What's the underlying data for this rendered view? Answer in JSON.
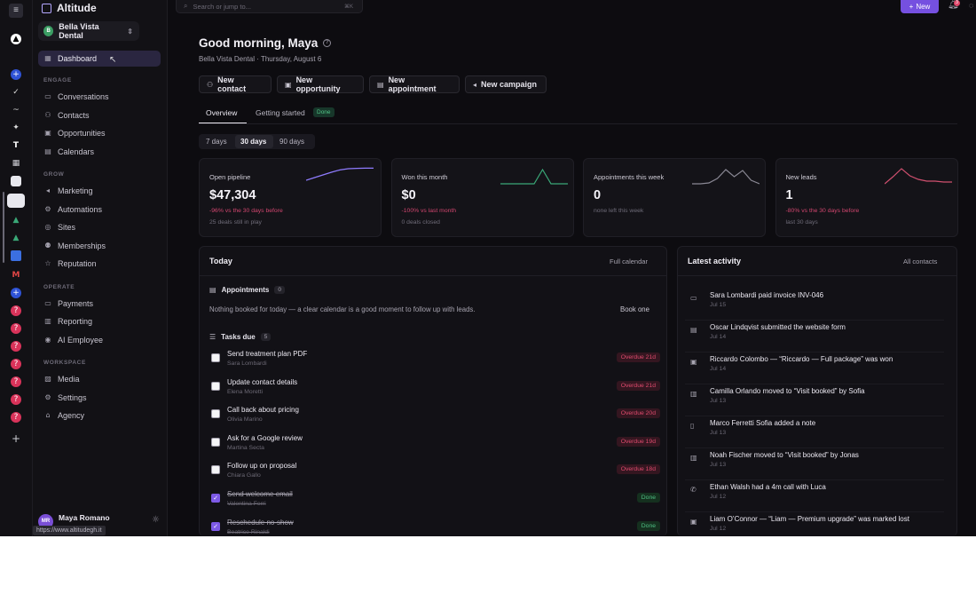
{
  "app": {
    "name": "Altitude",
    "account": "Bella Vista Dental",
    "account_initial": "B",
    "status_url": "https://www.altitudegh.it"
  },
  "sidebar": {
    "dashboard": "Dashboard",
    "sections": [
      {
        "title": "ENGAGE",
        "items": [
          "Conversations",
          "Contacts",
          "Opportunities",
          "Calendars"
        ]
      },
      {
        "title": "GROW",
        "items": [
          "Marketing",
          "Automations",
          "Sites",
          "Memberships",
          "Reputation"
        ]
      },
      {
        "title": "OPERATE",
        "items": [
          "Payments",
          "Reporting",
          "AI Employee"
        ]
      },
      {
        "title": "WORKSPACE",
        "items": [
          "Media",
          "Settings",
          "Agency"
        ]
      }
    ],
    "user": {
      "initials": "MR",
      "name": "Maya Romano"
    }
  },
  "topbar": {
    "search_placeholder": "Search or jump to...",
    "shortcut": "⌘K",
    "new_label": "New",
    "notification_count": "3"
  },
  "header": {
    "greeting": "Good morning, Maya",
    "subline": "Bella Vista Dental · Thursday, August 6",
    "actions": [
      "New contact",
      "New opportunity",
      "New appointment",
      "New campaign"
    ],
    "tabs": [
      "Overview",
      "Getting started"
    ],
    "tab_badge": "Done",
    "ranges": [
      "7 days",
      "30 days",
      "90 days"
    ],
    "selected_range": "30 days"
  },
  "kpis": [
    {
      "label": "Open pipeline",
      "value": "$47,304",
      "delta": "-96% vs the 30 days before",
      "foot": "25 deals still in play",
      "trend": [
        0.3,
        0.45,
        0.6,
        0.75,
        0.88,
        0.95,
        0.97,
        0.98,
        0.98
      ],
      "color": "#8f7cff"
    },
    {
      "label": "Won this month",
      "value": "$0",
      "delta": "-100% vs last month",
      "foot": "0 deals closed",
      "trend": [
        0.1,
        0.1,
        0.1,
        0.1,
        0.1,
        0.9,
        0.1,
        0.1,
        0.1
      ],
      "color": "#3aa877"
    },
    {
      "label": "Appointments this week",
      "value": "0",
      "delta": "none left this week",
      "foot": "",
      "trend": [
        0.1,
        0.1,
        0.15,
        0.4,
        0.9,
        0.5,
        0.85,
        0.3,
        0.1
      ],
      "color": "#8a8894"
    },
    {
      "label": "New leads",
      "value": "1",
      "delta": "-80% vs the 30 days before",
      "foot": "last 30 days",
      "trend": [
        0.1,
        0.5,
        0.95,
        0.55,
        0.35,
        0.25,
        0.25,
        0.2,
        0.2
      ],
      "color": "#d0506f"
    }
  ],
  "today": {
    "title": "Today",
    "link": "Full calendar",
    "appointments_label": "Appointments",
    "appointments_count": "0",
    "empty_text": "Nothing booked for today — a clear calendar is a good moment to follow up with leads.",
    "book_one": "Book one",
    "tasks_label": "Tasks due",
    "tasks_count": "5",
    "tasks": [
      {
        "title": "Send treatment plan PDF",
        "person": "Sara Lombardi",
        "status": "Overdue 21d",
        "done": false
      },
      {
        "title": "Update contact details",
        "person": "Elena Moretti",
        "status": "Overdue 21d",
        "done": false
      },
      {
        "title": "Call back about pricing",
        "person": "Olivia Marino",
        "status": "Overdue 20d",
        "done": false
      },
      {
        "title": "Ask for a Google review",
        "person": "Martina Secta",
        "status": "Overdue 19d",
        "done": false
      },
      {
        "title": "Follow up on proposal",
        "person": "Chiara Gallo",
        "status": "Overdue 18d",
        "done": false
      },
      {
        "title": "Send welcome email",
        "person": "Valentina Ferri",
        "status": "Done",
        "done": true
      },
      {
        "title": "Reschedule no-show",
        "person": "Beatrice Rinaldi",
        "status": "Done",
        "done": true
      }
    ]
  },
  "activity": {
    "title": "Latest activity",
    "link": "All contacts",
    "items": [
      {
        "icon": "invoice-icon",
        "text": "Sara Lombardi paid invoice INV-046",
        "date": "Jul 15"
      },
      {
        "icon": "form-icon",
        "text": "Oscar Lindqvist submitted the website form",
        "date": "Jul 14"
      },
      {
        "icon": "deal-icon",
        "text": "Riccardo Colombo — “Riccardo — Full package” was won",
        "date": "Jul 14"
      },
      {
        "icon": "stage-icon",
        "text": "Camilla Orlando moved to “Visit booked” by Sofia",
        "date": "Jul 13"
      },
      {
        "icon": "note-icon",
        "text": "Marco Ferretti Sofia added a note",
        "date": "Jul 13"
      },
      {
        "icon": "stage-icon",
        "text": "Noah Fischer moved to “Visit booked” by Jonas",
        "date": "Jul 13"
      },
      {
        "icon": "phone-icon",
        "text": "Ethan Walsh had a 4m call with Luca",
        "date": "Jul 12"
      },
      {
        "icon": "deal-icon",
        "text": "Liam O’Connor — “Liam — Premium upgrade” was marked lost",
        "date": "Jul 12"
      }
    ]
  }
}
